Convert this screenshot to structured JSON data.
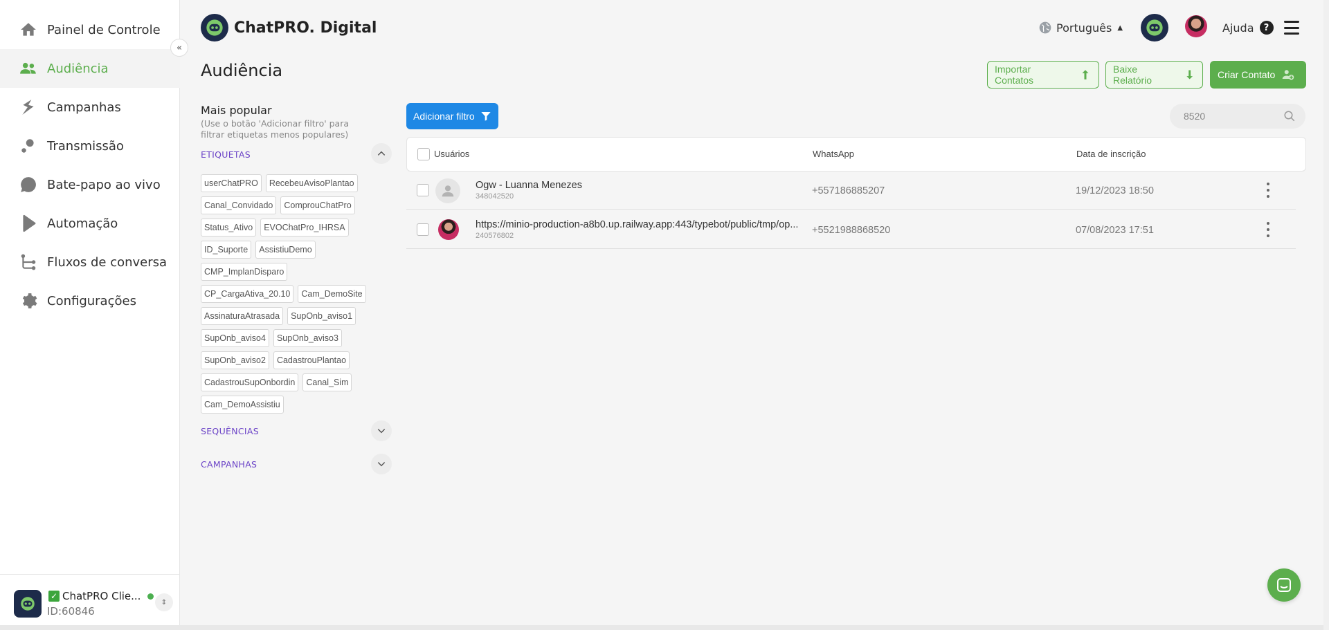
{
  "sidebar": {
    "items": [
      {
        "label": "Painel de Controle",
        "icon": "home-icon"
      },
      {
        "label": "Audiência",
        "icon": "users-icon",
        "active": true
      },
      {
        "label": "Campanhas",
        "icon": "campaign-icon"
      },
      {
        "label": "Transmissão",
        "icon": "broadcast-icon"
      },
      {
        "label": "Bate-papo ao vivo",
        "icon": "chat-bubble-icon"
      },
      {
        "label": "Automação",
        "icon": "play-icon"
      },
      {
        "label": "Fluxos de conversa",
        "icon": "flow-icon"
      },
      {
        "label": "Configurações",
        "icon": "gear-icon"
      }
    ],
    "footer": {
      "account_name": "ChatPRO Clie...",
      "account_id": "ID:60846"
    }
  },
  "header": {
    "brand": "ChatPRO. Digital",
    "language": "Português",
    "help": "Ajuda"
  },
  "page": {
    "title": "Audiência",
    "actions": {
      "import": "Importar Contatos",
      "report": "Baixe Relatório",
      "create": "Criar Contato"
    }
  },
  "filters": {
    "most_popular": "Mais popular",
    "hint": "(Use o botão 'Adicionar filtro' para filtrar etiquetas menos populares)",
    "sections": {
      "tags": "ETIQUETAS",
      "sequences": "SEQUÊNCIAS",
      "campaigns": "CAMPANHAS"
    },
    "tags": [
      "userChatPRO",
      "RecebeuAvisoPlantao",
      "Canal_Convidado",
      "ComprouChatPro",
      "Status_Ativo",
      "EVOChatPro_IHRSA",
      "ID_Suporte",
      "AssistiuDemo",
      "CMP_ImplanDisparo",
      "CP_CargaAtiva_20.10",
      "Cam_DemoSite",
      "AssinaturaAtrasada",
      "SupOnb_aviso1",
      "SupOnb_aviso4",
      "SupOnb_aviso3",
      "SupOnb_aviso2",
      "CadastrouPlantao",
      "CadastrouSupOnbordin",
      "Canal_Sim",
      "Cam_DemoAssistiu"
    ],
    "add_filter": "Adicionar filtro"
  },
  "search": {
    "value": "8520"
  },
  "table": {
    "headers": {
      "users": "Usuários",
      "whatsapp": "WhatsApp",
      "date": "Data de inscrição"
    },
    "rows": [
      {
        "name": "Ogw - Luanna Menezes",
        "id": "348042520",
        "whatsapp": "+557186885207",
        "date": "19/12/2023 18:50",
        "avatar": "default"
      },
      {
        "name": "https://minio-production-a8b0.up.railway.app:443/typebot/public/tmp/op...",
        "id": "240576802",
        "whatsapp": "+5521988868520",
        "date": "07/08/2023 17:51",
        "avatar": "photo"
      }
    ]
  },
  "colors": {
    "accent": "#5cae4d",
    "primary_blue": "#1e88e5",
    "section_purple": "#6b43c7"
  }
}
